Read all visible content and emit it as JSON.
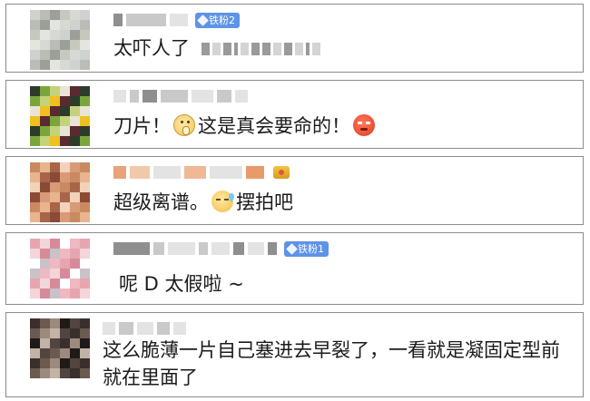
{
  "comments": [
    {
      "badge": "铁粉2",
      "text_prefix": "太吓人了",
      "avatar_colors": [
        "#cfd3cf",
        "#b9bdb6",
        "#9aa098",
        "#c6c8c0",
        "#e3e5e0",
        "#d7d9d3"
      ]
    },
    {
      "text_a": "刀片！",
      "emoji_a": "pray-smile-icon",
      "text_b": "这是真会要命的！",
      "emoji_b": "angry-face-icon",
      "avatar_colors": [
        "#2d3b2a",
        "#7aa53b",
        "#c4d27a",
        "#e8e4d6",
        "#f0c020",
        "#5a2a30"
      ]
    },
    {
      "text_a": "超级离谱。",
      "emoji_a": "cold-sweat-icon",
      "text_b": "摆拍吧",
      "avatar_colors": [
        "#c98a62",
        "#e8b58e",
        "#a8654a",
        "#f2d2b8",
        "#8a4a35",
        "#d99a78"
      ]
    },
    {
      "badge": "铁粉1",
      "text": "呢 D 太假啦 ~",
      "avatar_colors": [
        "#e6a6b0",
        "#f3d5da",
        "#d78a99",
        "#ffffff",
        "#c9c2c8",
        "#efb9c2"
      ]
    },
    {
      "text": "这么脆薄一片自己塞进去早裂了，一看就是凝固定型前就在里面了",
      "avatar_colors": [
        "#3a2f2b",
        "#6b5a50",
        "#9c8a7e",
        "#1f1a18",
        "#c2b3a6",
        "#524540"
      ]
    }
  ]
}
